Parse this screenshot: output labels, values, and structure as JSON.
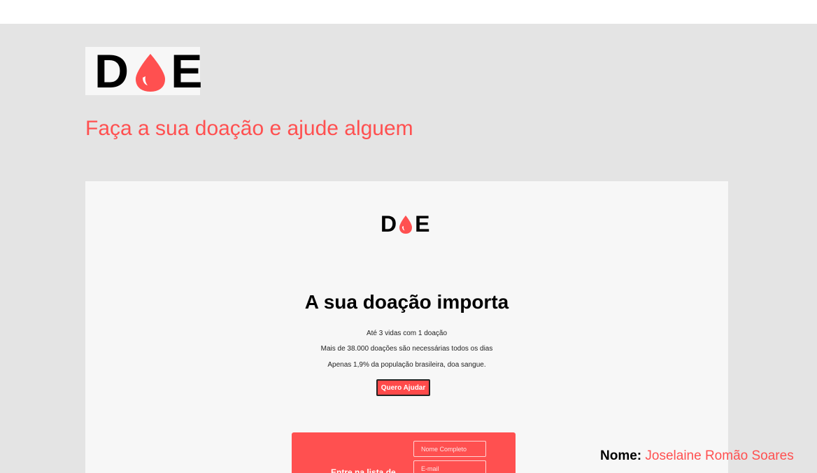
{
  "brand": {
    "logo_left": "D",
    "logo_right": "E",
    "drop_color": "#ff5050"
  },
  "slide": {
    "headline": "Faça a sua doação e ajude alguem"
  },
  "preview": {
    "hero_title": "A sua doação importa",
    "lines": [
      "Até 3 vidas com 1 doação",
      "Mais de 38.000 doações são necessárias todos os dias",
      "Apenas 1,9% da população brasileira, doa sangue."
    ],
    "help_button": "Quero Ajudar",
    "form": {
      "cta": "Entre na lista de",
      "name_placeholder": "Nome Completo",
      "email_placeholder": "E-mail"
    }
  },
  "author": {
    "label": "Nome:",
    "value": "Joselaine Romão Soares"
  },
  "colors": {
    "accent": "#ff5050",
    "slide_bg": "#e4e4e4",
    "preview_bg": "#f7f7f7"
  }
}
